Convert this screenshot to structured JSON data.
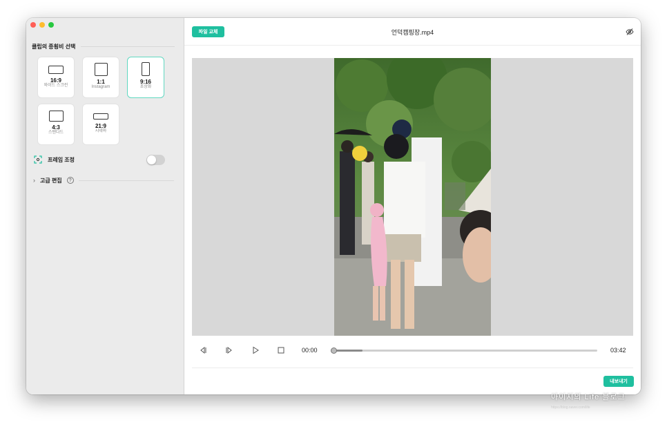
{
  "sidebar": {
    "section_title": "클립의 종횡비 선택",
    "ratios": [
      {
        "label": "16:9",
        "sub": "와이드 스크린",
        "selected": false
      },
      {
        "label": "1:1",
        "sub": "Instagram",
        "selected": false
      },
      {
        "label": "9:16",
        "sub": "초상화",
        "selected": true
      },
      {
        "label": "4:3",
        "sub": "스탠다드",
        "selected": false
      },
      {
        "label": "21:9",
        "sub": "시네마",
        "selected": false
      }
    ],
    "frame_adjust_label": "프레임 조정",
    "frame_adjust_on": false,
    "advanced_label": "고급 편집",
    "advanced_help": "?",
    "advanced_chevron": "›"
  },
  "topbar": {
    "replace_button": "파일 교체",
    "file_name": "언덕캠핑장.mp4"
  },
  "player": {
    "current_time": "00:00",
    "duration": "03:42",
    "buffered_fraction": 0.11
  },
  "footer": {
    "export_button": "내보내기"
  },
  "watermark": {
    "text": "아이지의 Life 블로그",
    "sub": "https://blog.naver.com/life"
  },
  "colors": {
    "accent": "#1fbf9f",
    "selected_border": "#5fd8c0"
  }
}
